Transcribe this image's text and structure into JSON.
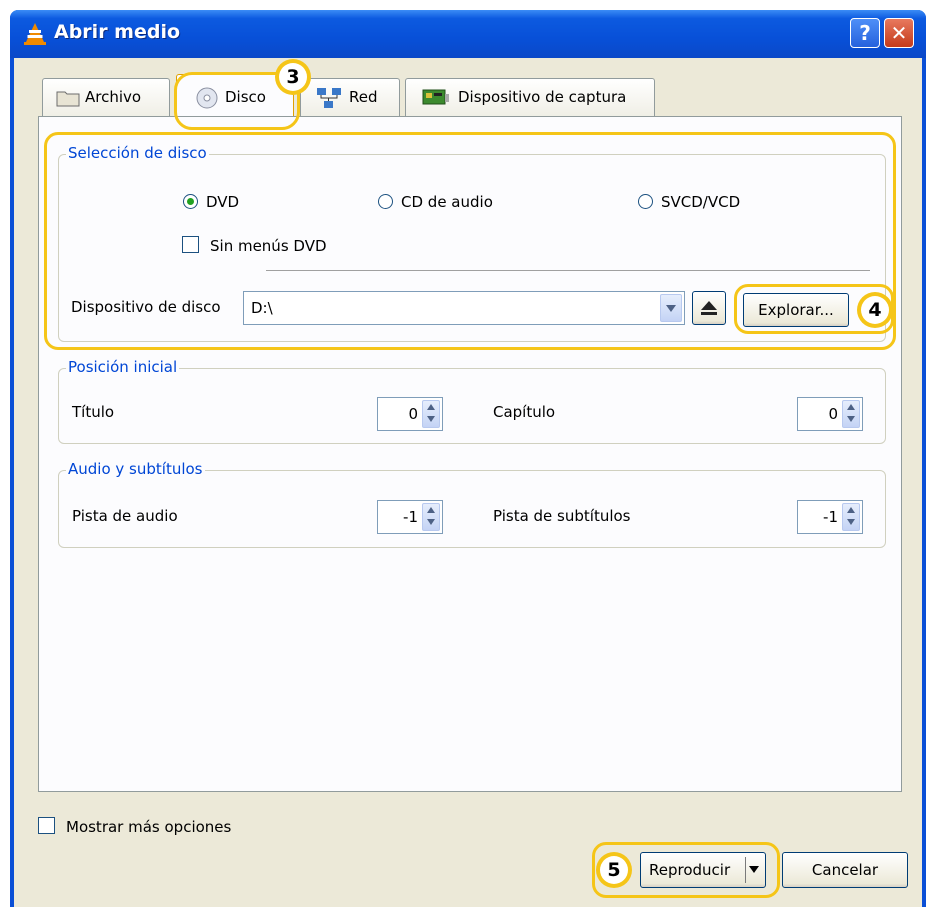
{
  "window": {
    "title": "Abrir medio",
    "help_glyph": "?",
    "close_glyph": "✕"
  },
  "tabs": [
    {
      "label": "Archivo",
      "icon": "folder-icon"
    },
    {
      "label": "Disco",
      "icon": "disc-icon",
      "active": true
    },
    {
      "label": "Red",
      "icon": "network-icon"
    },
    {
      "label": "Dispositivo de captura",
      "icon": "capture-card-icon"
    }
  ],
  "disc_selection": {
    "title": "Selección de disco",
    "options": [
      {
        "label": "DVD",
        "selected": true
      },
      {
        "label": "CD de audio",
        "selected": false
      },
      {
        "label": "SVCD/VCD",
        "selected": false
      }
    ],
    "no_menus_label": "Sin menús DVD",
    "no_menus_checked": false,
    "device_label": "Dispositivo de disco",
    "device_value": "D:\\",
    "browse_label": "Explorar..."
  },
  "start_position": {
    "title": "Posición inicial",
    "title_label": "Título",
    "title_value": "0",
    "chapter_label": "Capítulo",
    "chapter_value": "0"
  },
  "audio_subs": {
    "title": "Audio y subtítulos",
    "audio_label": "Pista de audio",
    "audio_value": "-1",
    "subs_label": "Pista de subtítulos",
    "subs_value": "-1"
  },
  "footer": {
    "more_options_label": "Mostrar más opciones",
    "more_options_checked": false,
    "play_label": "Reproducir",
    "cancel_label": "Cancelar"
  },
  "annotations": {
    "step3": "3",
    "step4": "4",
    "step5": "5",
    "highlight_color": "#f5c518"
  },
  "colors": {
    "titlebar": "#0a4fd6",
    "group_title": "#0046d5",
    "dialog_bg": "#ece9d8"
  }
}
